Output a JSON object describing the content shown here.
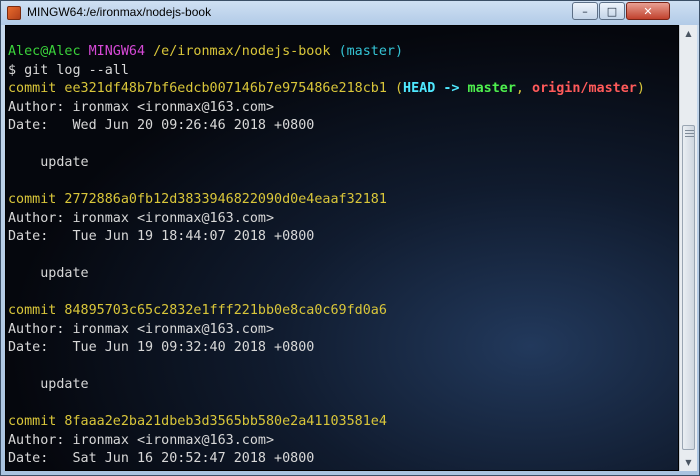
{
  "window": {
    "title": "MINGW64:/e/ironmax/nodejs-book",
    "buttons": {
      "minimize": "–",
      "maximize": "□",
      "close": "✕"
    },
    "icons": {
      "app": "git-bash-icon"
    }
  },
  "terminal": {
    "prompt": {
      "user_host": "Alec@Alec",
      "system": "MINGW64",
      "path": "/e/ironmax/nodejs-book",
      "branch": "(master)"
    },
    "command": "$ git log --all",
    "commits": [
      {
        "hash": "commit ee321df48b7bf6edcb007146b7e975486e218cb1",
        "refs": {
          "open": " (",
          "head": "HEAD -> ",
          "branch": "master",
          "sep": ", ",
          "remote": "origin/master",
          "close": ")"
        },
        "author": "Author: ironmax <ironmax@163.com>",
        "date": "Date:   Wed Jun 20 09:26:46 2018 +0800",
        "message": "    update"
      },
      {
        "hash": "commit 2772886a0fb12d3833946822090d0e4eaaf32181",
        "author": "Author: ironmax <ironmax@163.com>",
        "date": "Date:   Tue Jun 19 18:44:07 2018 +0800",
        "message": "    update"
      },
      {
        "hash": "commit 84895703c65c2832e1fff221bb0e8ca0c69fd0a6",
        "author": "Author: ironmax <ironmax@163.com>",
        "date": "Date:   Tue Jun 19 09:32:40 2018 +0800",
        "message": "    update"
      },
      {
        "hash": "commit 8faaa2e2ba21dbeb3d3565bb580e2a41103581e4",
        "author": "Author: ironmax <ironmax@163.com>",
        "date": "Date:   Sat Jun 16 20:52:47 2018 +0800"
      }
    ]
  },
  "scrollbar": {
    "up_icon": "▲",
    "down_icon": "▼"
  },
  "colors": {
    "prompt_user": "#3ad13a",
    "prompt_system": "#d649d6",
    "prompt_path": "#d9c63a",
    "prompt_branch": "#34c3d4",
    "commit_hash": "#d9c63a",
    "ref_head": "#4fe9ff",
    "ref_branch": "#4ef04e",
    "ref_remote": "#ff5a5a"
  }
}
